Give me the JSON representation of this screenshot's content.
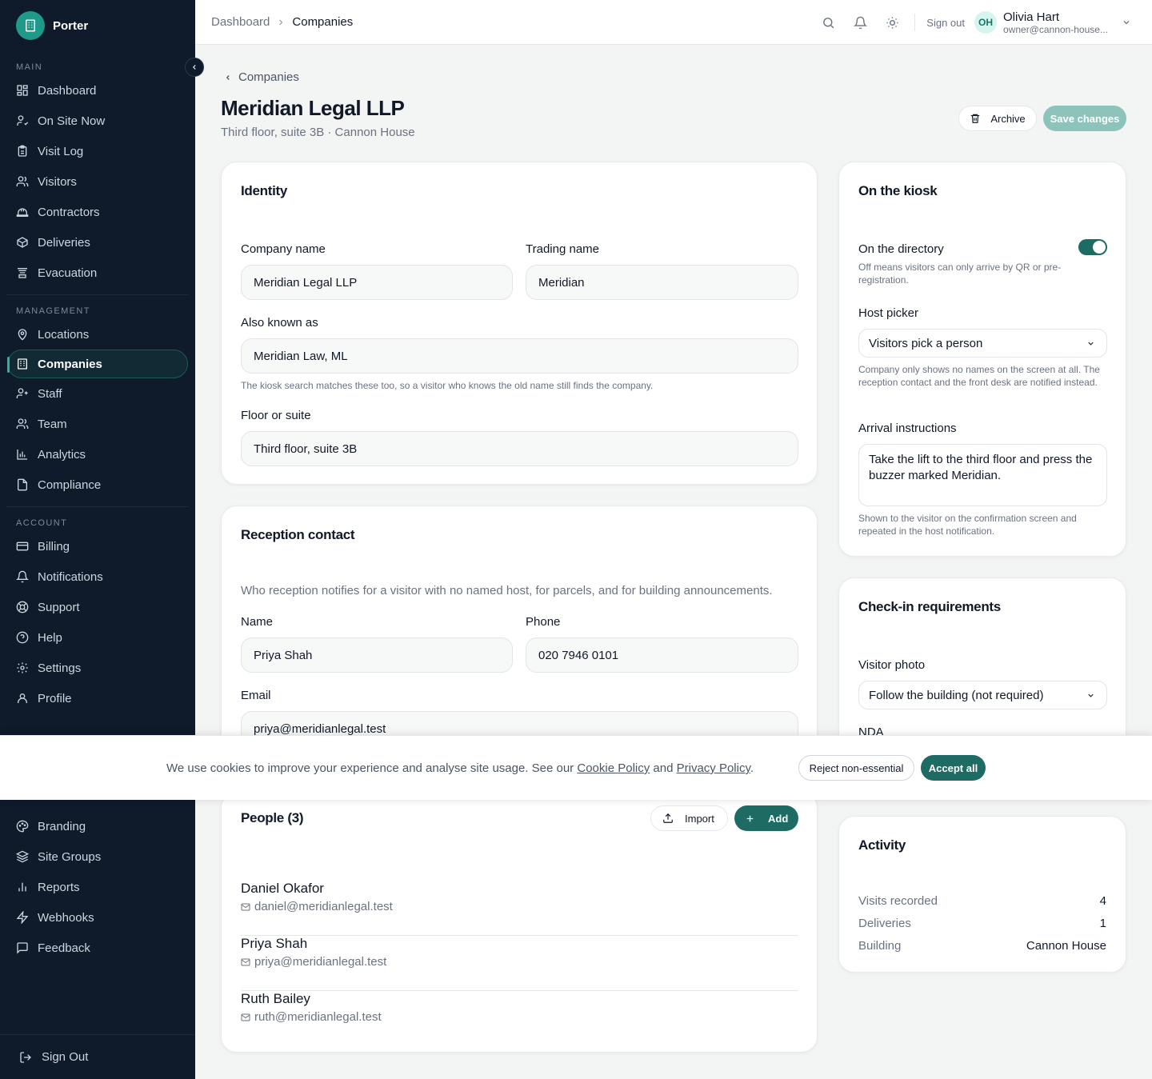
{
  "brand": {
    "name": "Porter"
  },
  "sidebar": {
    "sections": [
      {
        "label": "MAIN",
        "items": [
          {
            "label": "Dashboard",
            "icon": "grid-icon"
          },
          {
            "label": "On Site Now",
            "icon": "user-check-icon"
          },
          {
            "label": "Visit Log",
            "icon": "clipboard-icon"
          },
          {
            "label": "Visitors",
            "icon": "users-icon"
          },
          {
            "label": "Contractors",
            "icon": "hard-hat-icon"
          },
          {
            "label": "Deliveries",
            "icon": "package-icon"
          },
          {
            "label": "Evacuation",
            "icon": "siren-icon"
          }
        ]
      },
      {
        "label": "MANAGEMENT",
        "items": [
          {
            "label": "Locations",
            "icon": "map-pin-icon"
          },
          {
            "label": "Companies",
            "icon": "building-icon",
            "active": true
          },
          {
            "label": "Staff",
            "icon": "user-plus-icon"
          },
          {
            "label": "Team",
            "icon": "users-icon"
          },
          {
            "label": "Analytics",
            "icon": "bar-chart-icon"
          },
          {
            "label": "Compliance",
            "icon": "file-check-icon"
          }
        ]
      },
      {
        "label": "ACCOUNT",
        "items": [
          {
            "label": "Billing",
            "icon": "credit-card-icon"
          },
          {
            "label": "Notifications",
            "icon": "bell-icon"
          },
          {
            "label": "Support",
            "icon": "life-buoy-icon"
          },
          {
            "label": "Help",
            "icon": "help-circle-icon"
          },
          {
            "label": "Settings",
            "icon": "gear-icon"
          },
          {
            "label": "Profile",
            "icon": "user-icon"
          }
        ]
      }
    ],
    "lower_items": [
      {
        "label": "Branding",
        "icon": "palette-icon"
      },
      {
        "label": "Site Groups",
        "icon": "layers-icon"
      },
      {
        "label": "Reports",
        "icon": "bar-chart-icon"
      },
      {
        "label": "Webhooks",
        "icon": "zap-icon"
      },
      {
        "label": "Feedback",
        "icon": "message-square-icon"
      }
    ],
    "sign_out": "Sign Out"
  },
  "topbar": {
    "breadcrumb": [
      "Dashboard",
      "Companies"
    ],
    "sign_out": "Sign out",
    "user": {
      "initials": "OH",
      "name": "Olivia Hart",
      "email": "owner@cannon-house..."
    }
  },
  "page": {
    "back": "Companies",
    "title": "Meridian Legal LLP",
    "subtitle": "Third floor, suite 3B · Cannon House",
    "archive": "Archive",
    "save": "Save changes"
  },
  "identity": {
    "title": "Identity",
    "company_name_label": "Company name",
    "company_name": "Meridian Legal LLP",
    "trading_name_label": "Trading name",
    "trading_name": "Meridian",
    "aka_label": "Also known as",
    "aka": "Meridian Law, ML",
    "aka_hint": "The kiosk search matches these too, so a visitor who knows the old name still finds the company.",
    "floor_label": "Floor or suite",
    "floor": "Third floor, suite 3B"
  },
  "reception": {
    "title": "Reception contact",
    "description": "Who reception notifies for a visitor with no named host, for parcels, and for building announcements.",
    "name_label": "Name",
    "name": "Priya Shah",
    "phone_label": "Phone",
    "phone": "020 7946 0101",
    "email_label": "Email",
    "email": "priya@meridianlegal.test"
  },
  "people": {
    "title": "People (3)",
    "import": "Import",
    "add": "Add",
    "list": [
      {
        "name": "Daniel Okafor",
        "email": "daniel@meridianlegal.test"
      },
      {
        "name": "Priya Shah",
        "email": "priya@meridianlegal.test"
      },
      {
        "name": "Ruth Bailey",
        "email": "ruth@meridianlegal.test"
      }
    ]
  },
  "kiosk": {
    "title": "On the kiosk",
    "directory_label": "On the directory",
    "directory_on": true,
    "directory_hint": "Off means visitors can only arrive by QR or pre-registration.",
    "host_label": "Host picker",
    "host_value": "Visitors pick a person",
    "host_hint": "Company only shows no names on the screen at all. The reception contact and the front desk are notified instead.",
    "arrival_label": "Arrival instructions",
    "arrival_value": "Take the lift to the third floor and press the buzzer marked Meridian.",
    "arrival_hint": "Shown to the visitor on the confirmation screen and repeated in the host notification."
  },
  "checkin": {
    "title": "Check-in requirements",
    "photo_label": "Visitor photo",
    "photo_value": "Follow the building (not required)",
    "nda_label": "NDA"
  },
  "activity": {
    "title": "Activity",
    "rows": [
      {
        "label": "Visits recorded",
        "value": "4"
      },
      {
        "label": "Deliveries",
        "value": "1"
      },
      {
        "label": "Building",
        "value": "Cannon House"
      }
    ]
  },
  "cookie": {
    "text_before": "We use cookies to improve your experience and analyse site usage. See our ",
    "cookie_policy": "Cookie Policy",
    "and": " and ",
    "privacy_policy": "Privacy Policy",
    "period": ".",
    "reject": "Reject non-essential",
    "accept": "Accept all"
  },
  "colors": {
    "accent": "#1d6b62",
    "sidebar_bg": "#0f1a2b",
    "save_disabled": "#8cc4bb"
  }
}
